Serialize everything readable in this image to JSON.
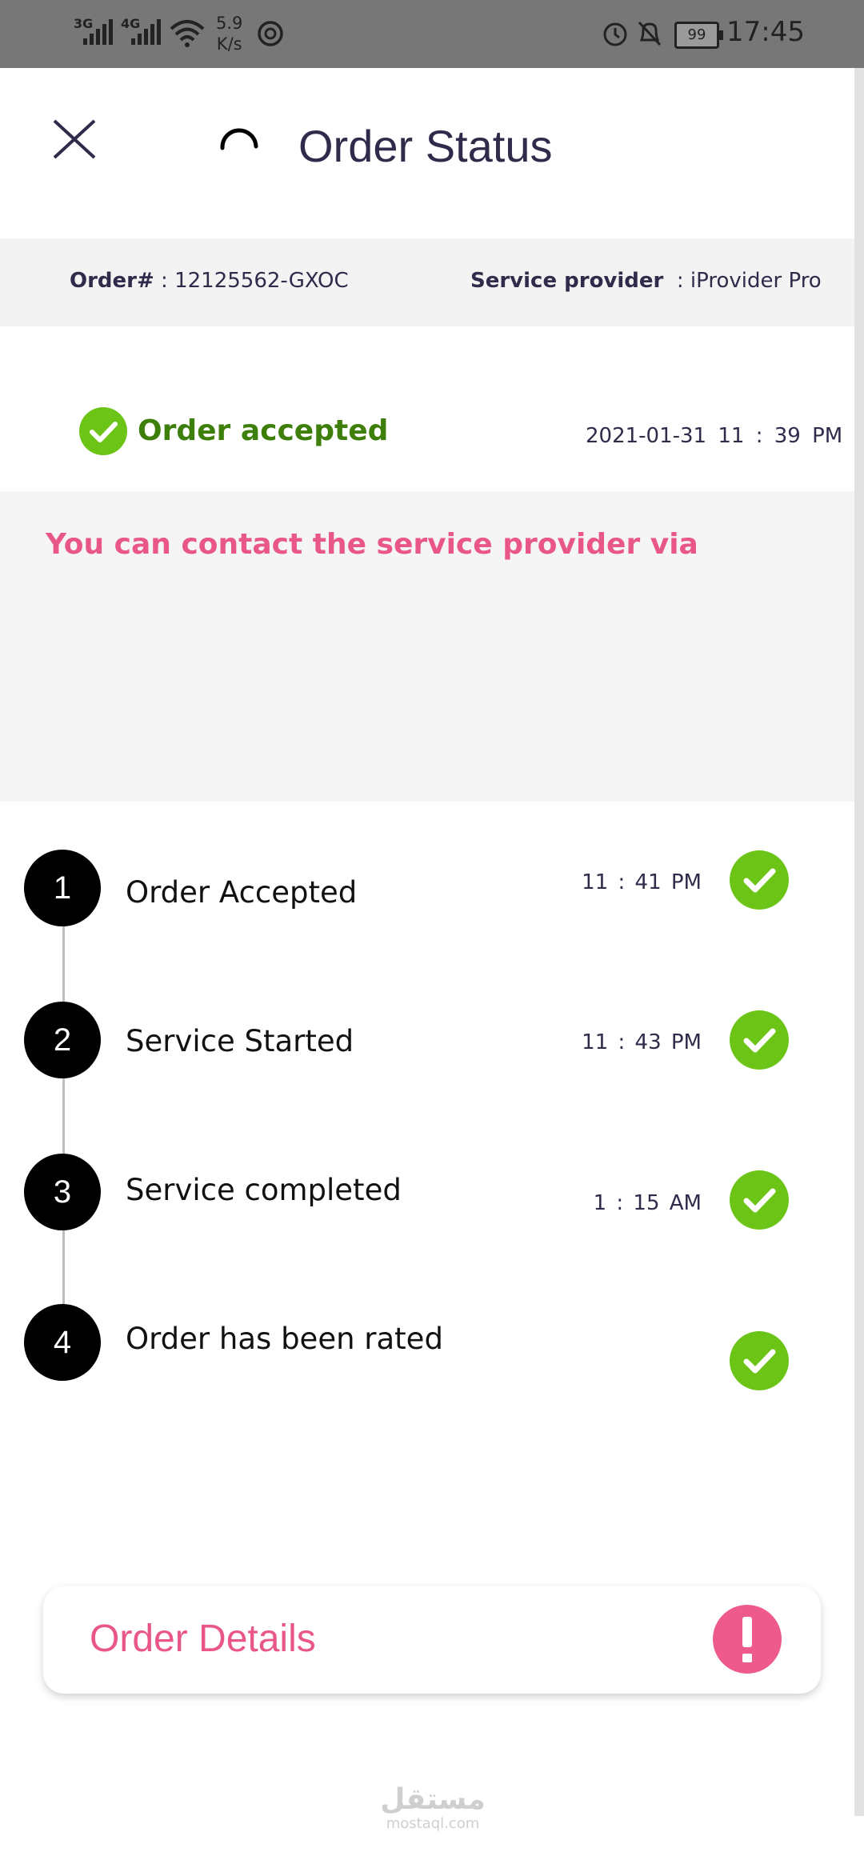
{
  "status_bar": {
    "network_1": "3G",
    "network_2": "4G",
    "speed_value": "5.9",
    "speed_unit": "K/s",
    "battery": "99",
    "time": "17:45"
  },
  "header": {
    "title": "Order Status",
    "close_icon": "close-icon",
    "loading_icon": "spinner-icon"
  },
  "order_info": {
    "order_label": "Order#",
    "order_value": ": 12125562-GXOC",
    "provider_label": "Service provider",
    "provider_value": ": iProvider Pro"
  },
  "accepted_banner": {
    "label": "Order accepted",
    "date": "2021-01-31  11 : 39 PM",
    "icon": "check-circle-icon"
  },
  "contact": {
    "text": "You can contact the service provider via"
  },
  "steps": [
    {
      "number": "1",
      "label": "Order Accepted",
      "time": "11 : 41 PM",
      "done": true
    },
    {
      "number": "2",
      "label": "Service Started",
      "time": "11 : 43 PM",
      "done": true
    },
    {
      "number": "3",
      "label": "Service completed",
      "time": "1 : 15 AM",
      "done": true
    },
    {
      "number": "4",
      "label": "Order has been rated",
      "time": "",
      "done": true
    }
  ],
  "order_details": {
    "label": "Order Details",
    "icon": "alert-icon"
  },
  "watermark": {
    "arabic": "مستقل",
    "latin": "mostaql.com"
  },
  "colors": {
    "accent_pink": "#e9578a",
    "success_green": "#6cc417",
    "title_navy": "#2f2b4a",
    "status_bar": "#777777"
  }
}
